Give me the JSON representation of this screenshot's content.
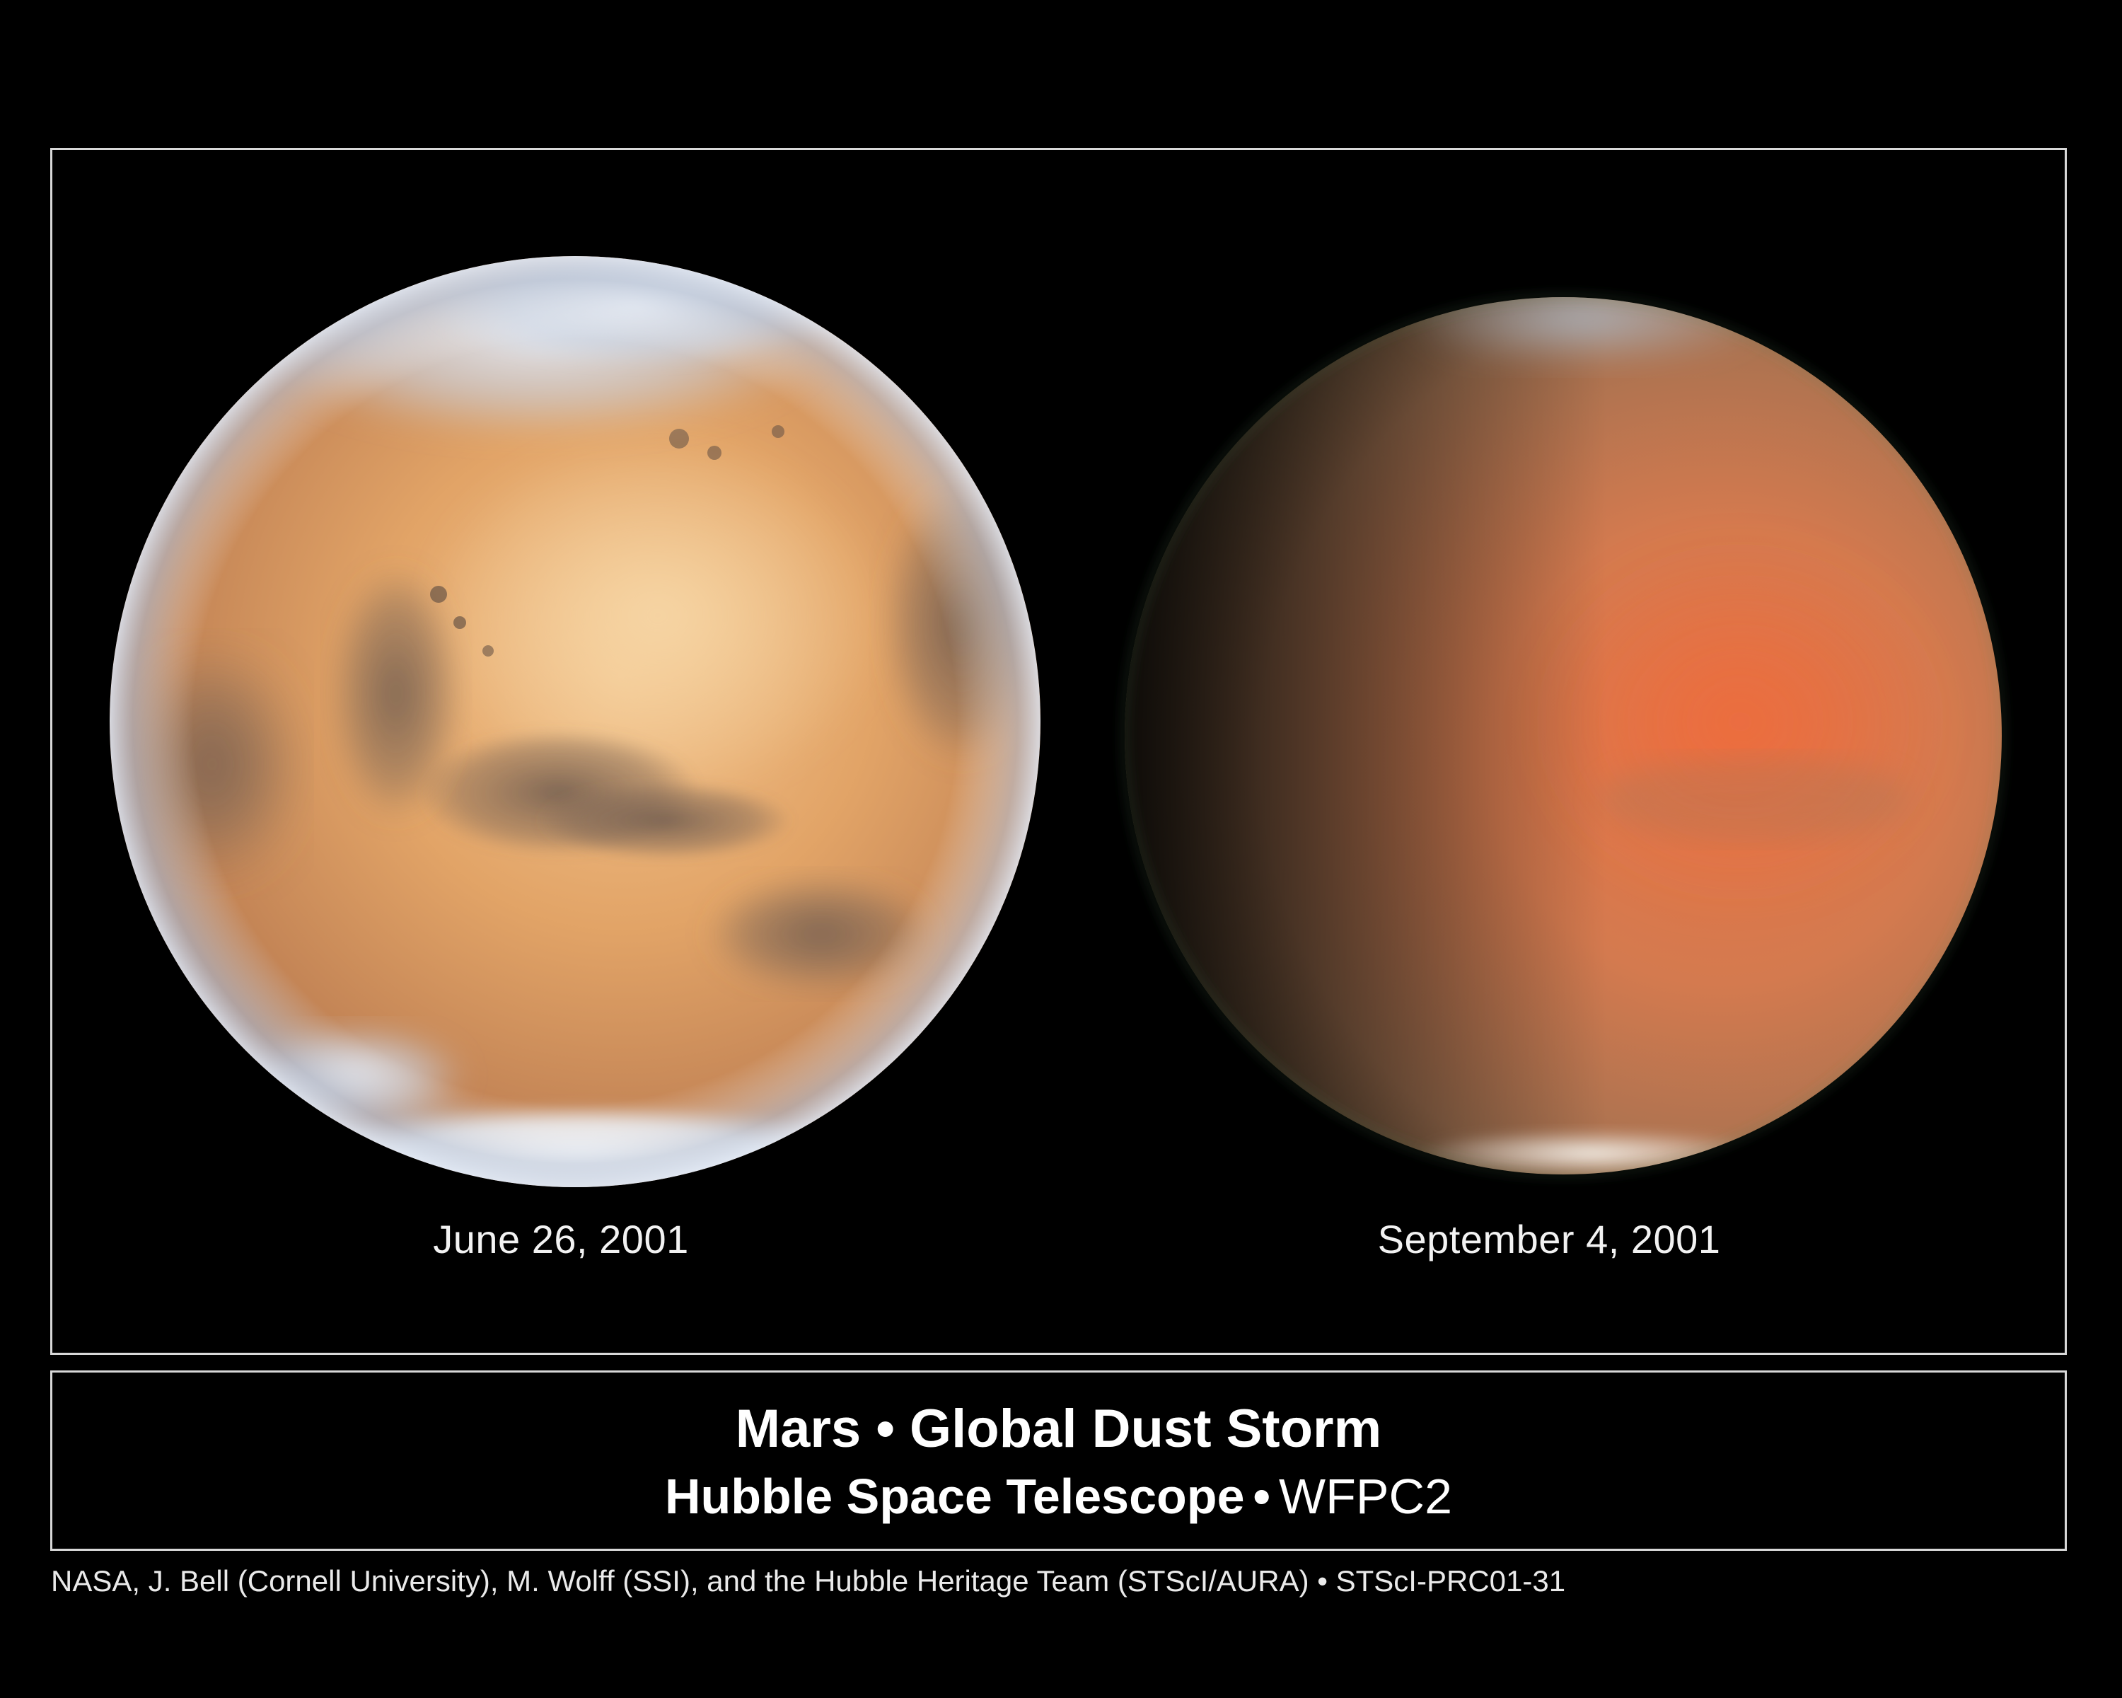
{
  "panels": [
    {
      "date_label": "June 26, 2001"
    },
    {
      "date_label": "September 4, 2001"
    }
  ],
  "title": {
    "line1": "Mars • Global Dust Storm",
    "line2_main": "Hubble Space Telescope",
    "line2_separator": "•",
    "line2_instrument": "WFPC2"
  },
  "credit": "NASA, J. Bell (Cornell University), M. Wolff (SSI), and the Hubble Heritage Team (STScI/AURA) • STScI-PRC01-31",
  "colors": {
    "background": "#000000",
    "frame": "#d8d8d8",
    "mars_clear": "#e3a266",
    "mars_storm": "#d9784a",
    "polar_cap": "#f0f2f6"
  }
}
